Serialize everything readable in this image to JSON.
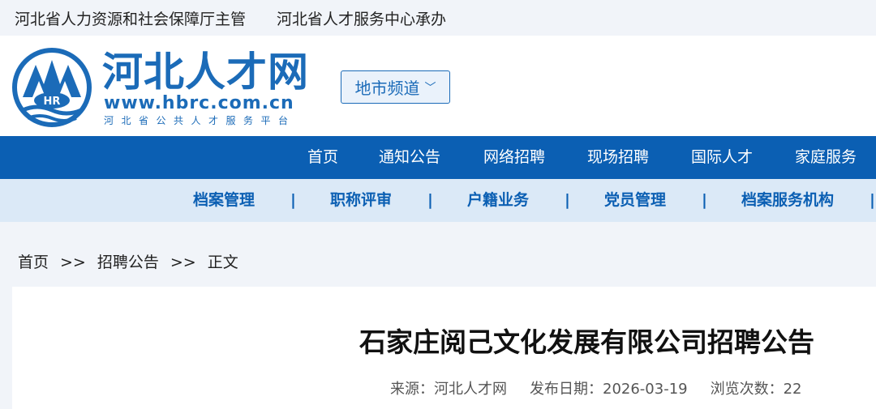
{
  "topbar": {
    "sponsor": "河北省人力资源和社会保障厅主管",
    "organizer": "河北省人才服务中心承办"
  },
  "header": {
    "logo_title": "河北人才网",
    "logo_url": "www.hbrc.com.cn",
    "logo_subtitle": "河北省公共人才服务平台",
    "logo_badge": "HR",
    "city_channel": "地市频道"
  },
  "nav_primary": [
    {
      "label": "首页"
    },
    {
      "label": "通知公告"
    },
    {
      "label": "网络招聘"
    },
    {
      "label": "现场招聘"
    },
    {
      "label": "国际人才"
    },
    {
      "label": "家庭服务"
    }
  ],
  "nav_secondary": [
    {
      "label": "档案管理"
    },
    {
      "label": "职称评审"
    },
    {
      "label": "户籍业务"
    },
    {
      "label": "党员管理"
    },
    {
      "label": "档案服务机构"
    }
  ],
  "breadcrumb": {
    "home": "首页",
    "section": "招聘公告",
    "current": "正文",
    "separator": ">>"
  },
  "article": {
    "title": "石家庄阅己文化发展有限公司招聘公告",
    "source_label": "来源：",
    "source": "河北人才网",
    "date_label": "发布日期：",
    "date": "2026-03-19",
    "views_label": "浏览次数：",
    "views": "22"
  },
  "colors": {
    "brand": "#0b5fb3",
    "nav_secondary_bg": "#dbe9f7",
    "page_bg": "#f1f4f9"
  }
}
